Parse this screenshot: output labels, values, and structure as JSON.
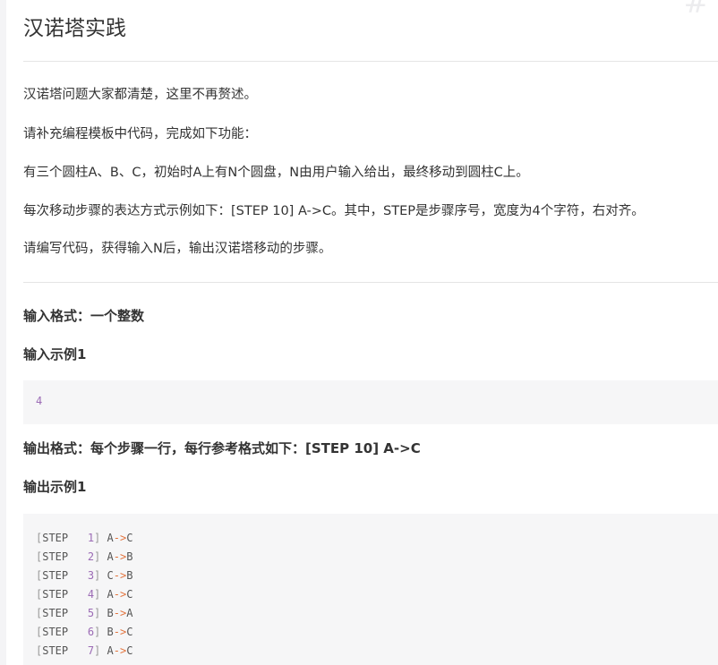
{
  "title": "汉诺塔实践",
  "intro": [
    "汉诺塔问题大家都清楚，这里不再赘述。",
    "请补充编程模板中代码，完成如下功能：",
    "有三个圆柱A、B、C，初始时A上有N个圆盘，N由用户输入给出，最终移动到圆柱C上。",
    "每次移动步骤的表达方式示例如下：[STEP 10] A->C。其中，STEP是步骤序号，宽度为4个字符，右对齐。",
    "请编写代码，获得输入N后，输出汉诺塔移动的步骤。"
  ],
  "input_format": "输入格式：一个整数",
  "input_example_label": "输入示例1",
  "input_example_value": "4",
  "output_format": "输出格式：每个步骤一行，每行参考格式如下：[STEP 10] A->C",
  "output_example_label": "输出示例1",
  "output_lines": [
    {
      "open": "[",
      "step": "STEP",
      "num": "   1",
      "close": "]",
      "from": "A",
      "arrow": "->",
      "to": "C"
    },
    {
      "open": "[",
      "step": "STEP",
      "num": "   2",
      "close": "]",
      "from": "A",
      "arrow": "->",
      "to": "B"
    },
    {
      "open": "[",
      "step": "STEP",
      "num": "   3",
      "close": "]",
      "from": "C",
      "arrow": "->",
      "to": "B"
    },
    {
      "open": "[",
      "step": "STEP",
      "num": "   4",
      "close": "]",
      "from": "A",
      "arrow": "->",
      "to": "C"
    },
    {
      "open": "[",
      "step": "STEP",
      "num": "   5",
      "close": "]",
      "from": "B",
      "arrow": "->",
      "to": "A"
    },
    {
      "open": "[",
      "step": "STEP",
      "num": "   6",
      "close": "]",
      "from": "B",
      "arrow": "->",
      "to": "C"
    },
    {
      "open": "[",
      "step": "STEP",
      "num": "   7",
      "close": "]",
      "from": "A",
      "arrow": "->",
      "to": "C"
    }
  ],
  "corner_glyph": "#",
  "colors": {
    "text": "#333333",
    "code_bg": "#f6f6f7",
    "number": "#9b6bb5",
    "arrow": "#e3733c"
  }
}
